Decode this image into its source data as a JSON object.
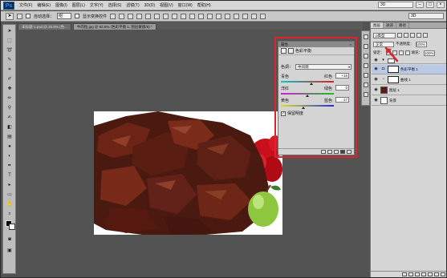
{
  "app": {
    "logo": "Ps",
    "menu": [
      "文件(F)",
      "编辑(E)",
      "图像(I)",
      "图层(L)",
      "文字(Y)",
      "选择(S)",
      "滤镜(T)",
      "3D(D)",
      "视图(V)",
      "窗口(W)",
      "帮助(H)"
    ],
    "workspace": "3D",
    "window_controls": [
      "–",
      "□",
      "×"
    ]
  },
  "options": {
    "auto_select_label": "自动选择：",
    "auto_select_value": "组",
    "show_transform_label": "显示变换控件",
    "right_box": "3D"
  },
  "tabs": [
    {
      "label": "未标题-1.psd @ 25.8% (色...",
      "active": false
    },
    {
      "label": "牛肉粒.jpg @ 82.6% (色彩平衡 1, 图层蒙版/8) *",
      "active": true
    }
  ],
  "properties": {
    "title": "属性",
    "header_label": "色彩平衡",
    "tone_label": "色调：",
    "tone_value": "中间调",
    "sliders": [
      {
        "left": "青色",
        "right": "红色",
        "value": "+16",
        "fraction": 0.58,
        "gradient": [
          "#00c8c8",
          "#e02020"
        ]
      },
      {
        "left": "洋红",
        "right": "绿色",
        "value": "0",
        "fraction": 0.5,
        "gradient": [
          "#d020d0",
          "#20c020"
        ]
      },
      {
        "left": "黄色",
        "right": "蓝色",
        "value": "-17",
        "fraction": 0.42,
        "gradient": [
          "#e0e020",
          "#2030e0"
        ]
      }
    ],
    "preserve_label": "保留明度",
    "preserve_checked": "✓"
  },
  "layers": {
    "tabs": [
      "图层",
      "通道",
      "路径"
    ],
    "kind_label": "ρ类型",
    "blend_mode": "正常",
    "opacity_label": "不透明度：",
    "opacity_value": "100%",
    "lock_label": "锁定：",
    "fill_label": "填充：",
    "fill_value": "100%",
    "items": [
      {
        "name": "色彩平衡 1",
        "selected": true
      },
      {
        "name": "曲线 1",
        "selected": false
      },
      {
        "name": "图层 1",
        "selected": false
      },
      {
        "name": "背景",
        "selected": false
      }
    ]
  },
  "colors": {
    "highlight": "#e0222b",
    "canvas_bg": "#535353"
  }
}
